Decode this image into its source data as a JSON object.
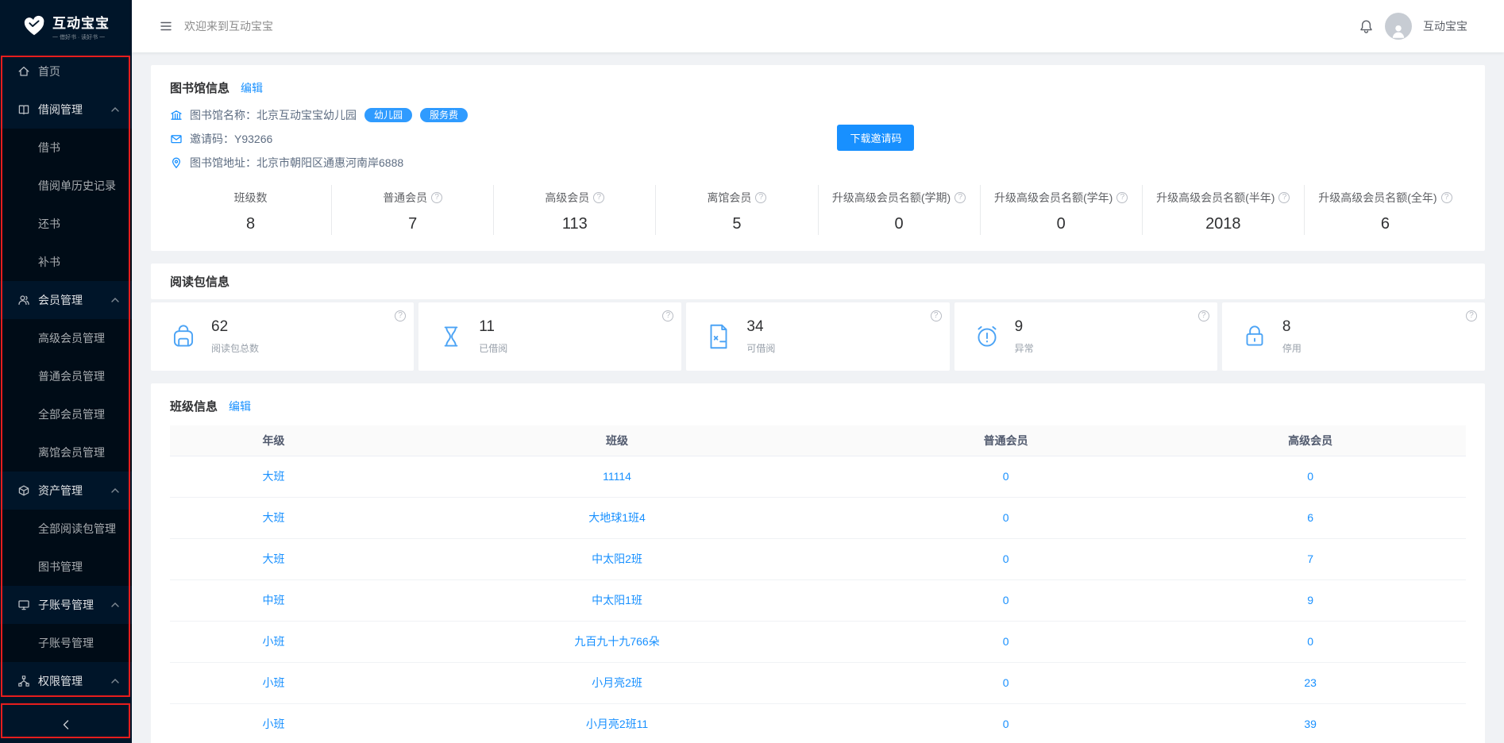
{
  "brand": {
    "name": "互动宝宝",
    "tagline": "一 借好书 · 读好书 一"
  },
  "header": {
    "welcome": "欢迎来到互动宝宝",
    "user": "互动宝宝"
  },
  "sidebar": {
    "items": [
      {
        "label": "首页"
      },
      {
        "label": "借阅管理",
        "children": [
          {
            "label": "借书"
          },
          {
            "label": "借阅单历史记录"
          },
          {
            "label": "还书"
          },
          {
            "label": "补书"
          }
        ]
      },
      {
        "label": "会员管理",
        "children": [
          {
            "label": "高级会员管理"
          },
          {
            "label": "普通会员管理"
          },
          {
            "label": "全部会员管理"
          },
          {
            "label": "离馆会员管理"
          }
        ]
      },
      {
        "label": "资产管理",
        "children": [
          {
            "label": "全部阅读包管理"
          },
          {
            "label": "图书管理"
          }
        ]
      },
      {
        "label": "子账号管理",
        "children": [
          {
            "label": "子账号管理"
          }
        ]
      },
      {
        "label": "权限管理",
        "children": []
      }
    ]
  },
  "library": {
    "title": "图书馆信息",
    "edit": "编辑",
    "rows": [
      {
        "label": "图书馆名称：北京互动宝宝幼儿园",
        "badges": [
          "幼儿园",
          "服务费"
        ]
      },
      {
        "label": "邀请码：Y93266"
      },
      {
        "label": "图书馆地址：北京市朝阳区通惠河南岸6888"
      }
    ],
    "download_btn": "下载邀请码",
    "stats": [
      {
        "label": "班级数",
        "value": "8",
        "help": false
      },
      {
        "label": "普通会员",
        "value": "7",
        "help": true
      },
      {
        "label": "高级会员",
        "value": "113",
        "help": true
      },
      {
        "label": "离馆会员",
        "value": "5",
        "help": true
      },
      {
        "label": "升级高级会员名额(学期)",
        "value": "0",
        "help": true
      },
      {
        "label": "升级高级会员名额(学年)",
        "value": "0",
        "help": true
      },
      {
        "label": "升级高级会员名额(半年)",
        "value": "2018",
        "help": true
      },
      {
        "label": "升级高级会员名额(全年)",
        "value": "6",
        "help": true
      }
    ]
  },
  "reading": {
    "title": "阅读包信息",
    "stats": [
      {
        "value": "62",
        "label": "阅读包总数",
        "icon": "backpack-icon"
      },
      {
        "value": "11",
        "label": "已借阅",
        "icon": "hourglass-icon"
      },
      {
        "value": "34",
        "label": "可借阅",
        "icon": "file-icon"
      },
      {
        "value": "9",
        "label": "异常",
        "icon": "alarm-icon"
      },
      {
        "value": "8",
        "label": "停用",
        "icon": "lock-icon"
      }
    ]
  },
  "classes": {
    "title": "班级信息",
    "edit": "编辑",
    "headers": [
      "年级",
      "班级",
      "普通会员",
      "高级会员"
    ],
    "rows": [
      [
        "大班",
        "11114",
        "0",
        "0"
      ],
      [
        "大班",
        "大地球1班4",
        "0",
        "6"
      ],
      [
        "大班",
        "中太阳2班",
        "0",
        "7"
      ],
      [
        "中班",
        "中太阳1班",
        "0",
        "9"
      ],
      [
        "小班",
        "九百九十九766朵",
        "0",
        "0"
      ],
      [
        "小班",
        "小月亮2班",
        "0",
        "23"
      ],
      [
        "小班",
        "小月亮2班11",
        "0",
        "39"
      ]
    ]
  },
  "colors": {
    "accent": "#1890ff",
    "sidebar_bg": "#001529",
    "submenu_bg": "#000c17",
    "content_bg": "#f0f2f5",
    "badge_bg": "#2f9bff",
    "annotation_red": "#e71d1d",
    "link": "#1890ff"
  },
  "icons": {
    "logo": "heart-hands",
    "home": "house",
    "borrow-group": "open-book",
    "member-group": "team",
    "asset-group": "box",
    "subaccount-group": "monitor",
    "permission-group": "cluster-nodes",
    "chevron-up": "^",
    "collapse": "‹",
    "menu-list": "≡",
    "notification": "bell",
    "avatar": "user-circle",
    "library-name": "bank",
    "invite-code": "envelope",
    "address": "location-pin",
    "help": "?",
    "reading-total": "backpack",
    "borrowed": "hourglass",
    "available": "file",
    "abnormal": "alarm-clock",
    "disabled": "lock"
  }
}
